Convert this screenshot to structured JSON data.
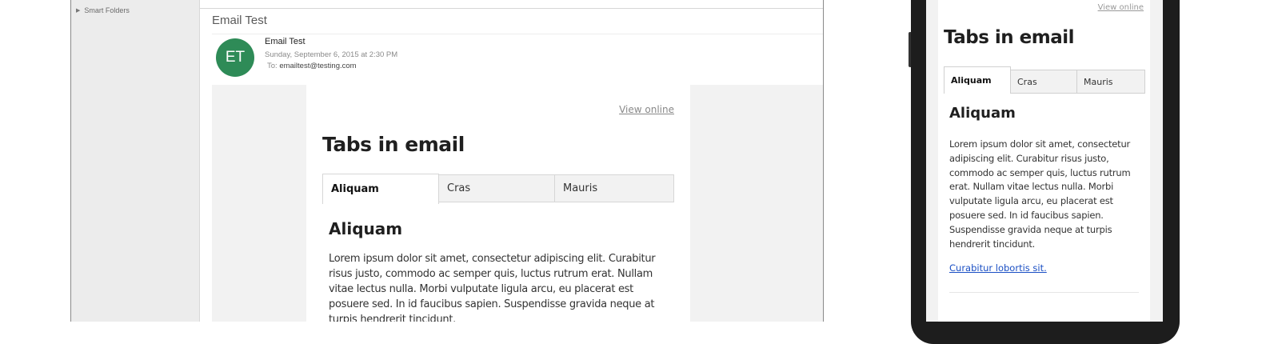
{
  "desktop": {
    "sidebar": {
      "smart_folders_label": "Smart Folders"
    },
    "message": {
      "subject": "Email Test",
      "avatar_initials": "ET",
      "avatar_color": "#2e8b57",
      "from_name": "Email Test",
      "date": "Sunday, September 6, 2015 at 2:30 PM",
      "to_label": "To:",
      "to_address": "emailtest@testing.com"
    },
    "email": {
      "view_online": "View online",
      "title": "Tabs in email",
      "tabs": [
        "Aliquam",
        "Cras",
        "Mauris"
      ],
      "active_tab": "Aliquam",
      "heading": "Aliquam",
      "body": "Lorem ipsum dolor sit amet, consectetur adipiscing elit. Curabitur risus justo, commodo ac semper quis, luctus rutrum erat. Nullam vitae lectus nulla. Morbi vulputate ligula arcu, eu placerat est posuere sed. In id faucibus sapien. Suspendisse gravida neque at turpis hendrerit tincidunt."
    }
  },
  "phone": {
    "email": {
      "view_online": "View online",
      "title": "Tabs in email",
      "tabs": [
        "Aliquam",
        "Cras",
        "Mauris"
      ],
      "active_tab": "Aliquam",
      "heading": "Aliquam",
      "body": "Lorem ipsum dolor sit amet, consectetur adipiscing elit. Curabitur risus justo, commodo ac semper quis, luctus rutrum erat. Nullam vitae lectus nulla. Morbi vulputate ligula arcu, eu placerat est posuere sed. In id faucibus sapien. Suspendisse gravida neque at turpis hendrerit tincidunt.",
      "link": "Curabitur lobortis sit."
    }
  }
}
